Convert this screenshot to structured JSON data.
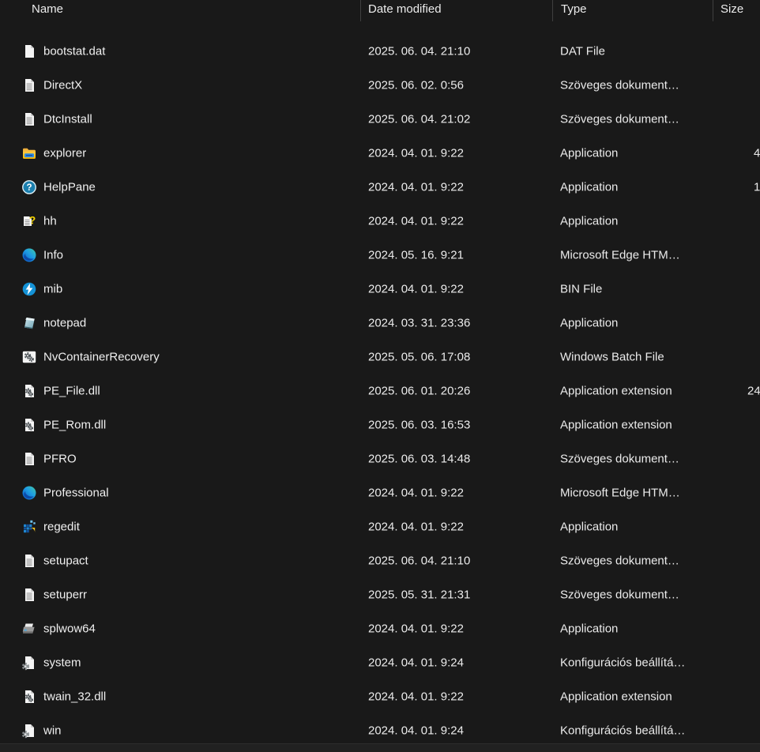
{
  "columns": [
    {
      "id": "name",
      "label": "Name"
    },
    {
      "id": "date_modified",
      "label": "Date modified"
    },
    {
      "id": "type",
      "label": "Type"
    },
    {
      "id": "size",
      "label": "Size"
    }
  ],
  "header": {
    "type_fragment": ".."
  },
  "files": [
    {
      "name": "bootstat.dat",
      "icon": "blank-file",
      "date_modified": "2025. 06. 04. 21:10",
      "type": "DAT File",
      "size_fragment": ""
    },
    {
      "name": "DirectX",
      "icon": "text-file",
      "date_modified": "2025. 06. 02. 0:56",
      "type": "Szöveges dokument…",
      "size_fragment": ""
    },
    {
      "name": "DtcInstall",
      "icon": "text-file",
      "date_modified": "2025. 06. 04. 21:02",
      "type": "Szöveges dokument…",
      "size_fragment": ""
    },
    {
      "name": "explorer",
      "icon": "explorer",
      "date_modified": "2024. 04. 01. 9:22",
      "type": "Application",
      "size_fragment": "4"
    },
    {
      "name": "HelpPane",
      "icon": "help",
      "date_modified": "2024. 04. 01. 9:22",
      "type": "Application",
      "size_fragment": "1"
    },
    {
      "name": "hh",
      "icon": "hh-help",
      "date_modified": "2024. 04. 01. 9:22",
      "type": "Application",
      "size_fragment": ""
    },
    {
      "name": "Info",
      "icon": "edge",
      "date_modified": "2024. 05. 16. 9:21",
      "type": "Microsoft Edge HTM…",
      "size_fragment": ""
    },
    {
      "name": "mib",
      "icon": "mib-bolt",
      "date_modified": "2024. 04. 01. 9:22",
      "type": "BIN File",
      "size_fragment": ""
    },
    {
      "name": "notepad",
      "icon": "notepad",
      "date_modified": "2024. 03. 31. 23:36",
      "type": "Application",
      "size_fragment": ""
    },
    {
      "name": "NvContainerRecovery",
      "icon": "batch-gears",
      "date_modified": "2025. 05. 06. 17:08",
      "type": "Windows Batch File",
      "size_fragment": ""
    },
    {
      "name": "PE_File.dll",
      "icon": "dll-gears",
      "date_modified": "2025. 06. 01. 20:26",
      "type": "Application extension",
      "size_fragment": "24"
    },
    {
      "name": "PE_Rom.dll",
      "icon": "dll-gears",
      "date_modified": "2025. 06. 03. 16:53",
      "type": "Application extension",
      "size_fragment": ""
    },
    {
      "name": "PFRO",
      "icon": "text-file",
      "date_modified": "2025. 06. 03. 14:48",
      "type": "Szöveges dokument…",
      "size_fragment": ""
    },
    {
      "name": "Professional",
      "icon": "edge",
      "date_modified": "2024. 04. 01. 9:22",
      "type": "Microsoft Edge HTM…",
      "size_fragment": ""
    },
    {
      "name": "regedit",
      "icon": "regedit",
      "date_modified": "2024. 04. 01. 9:22",
      "type": "Application",
      "size_fragment": ""
    },
    {
      "name": "setupact",
      "icon": "text-file",
      "date_modified": "2025. 06. 04. 21:10",
      "type": "Szöveges dokument…",
      "size_fragment": ""
    },
    {
      "name": "setuperr",
      "icon": "text-file",
      "date_modified": "2025. 05. 31. 21:31",
      "type": "Szöveges dokument…",
      "size_fragment": ""
    },
    {
      "name": "splwow64",
      "icon": "printer",
      "date_modified": "2024. 04. 01. 9:22",
      "type": "Application",
      "size_fragment": ""
    },
    {
      "name": "system",
      "icon": "ini-gear",
      "date_modified": "2024. 04. 01. 9:24",
      "type": "Konfigurációs beállítá…",
      "size_fragment": ""
    },
    {
      "name": "twain_32.dll",
      "icon": "dll-gears",
      "date_modified": "2024. 04. 01. 9:22",
      "type": "Application extension",
      "size_fragment": ""
    },
    {
      "name": "win",
      "icon": "ini-gear",
      "date_modified": "2024. 04. 01. 9:24",
      "type": "Konfigurációs beállítá…",
      "size_fragment": ""
    }
  ],
  "colors": {
    "background": "#191919",
    "row_text": "#f0f0f0",
    "header_text": "#ececec",
    "column_divider": "#3f3f3f",
    "bottom_bar": "#212121",
    "page_white": "#f4f4f4",
    "page_fold": "#cfcfcf",
    "doc_lines": "#9b9b9b",
    "folder_amber": "#e9a83c",
    "folder_yellow": "#ffc93c",
    "explorer_bar_blue": "#2e8adf",
    "explorer_bar_dark": "#13479c",
    "help_teal": "#1b7fae",
    "edge_blue": "#0b54c4",
    "edge_cyan": "#1e9de3",
    "edge_green": "#41c9a4",
    "bin_blue": "#1492d6",
    "hh_yellow": "#f5d400",
    "gear_dark": "#50565a",
    "gear_gray": "#8f9496",
    "notepad_teal": "#6fa3b5",
    "notepad_light": "#cfe8ee",
    "regedit_blue": "#1f86d0",
    "regedit_dark_blue": "#12519b",
    "regedit_light_blue": "#6ec0ea",
    "regedit_yellow": "#f6c51e",
    "printer_gray": "#9a9a9a",
    "printer_dark": "#6e6e6e",
    "printer_blue": "#49a8dd"
  }
}
